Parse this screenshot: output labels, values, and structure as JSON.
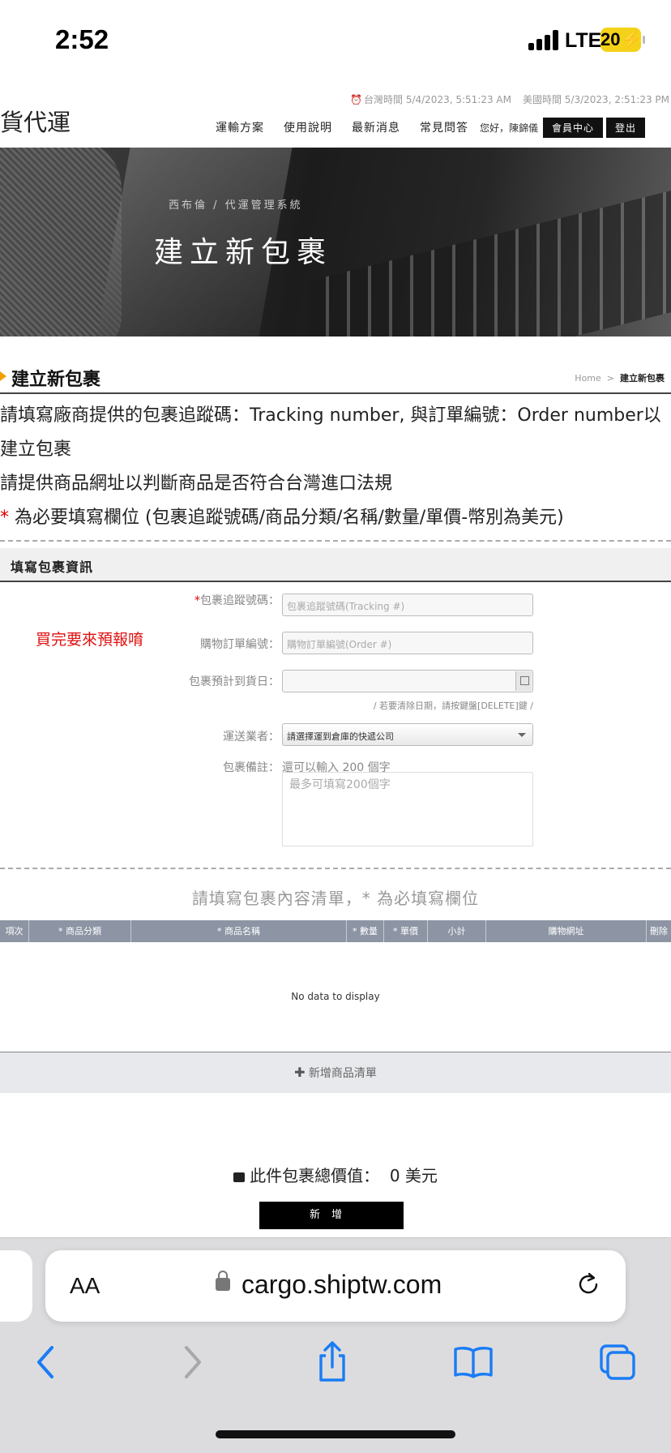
{
  "status_bar": {
    "time": "2:52",
    "network": "LTE",
    "battery": "20"
  },
  "site": {
    "logo": "貨代運",
    "tw_time": "台灣時間 5/4/2023, 5:51:23 AM",
    "us_time": "美國時間 5/3/2023, 2:51:23 PM",
    "nav": [
      "運輸方案",
      "使用說明",
      "最新消息",
      "常見問答"
    ],
    "greeting": "您好，陳錦儀",
    "member_center": "會員中心",
    "logout": "登出"
  },
  "hero": {
    "breadcrumb": "西布倫 / 代運管理系統",
    "title": "建立新包裹"
  },
  "section": {
    "title": "建立新包裹",
    "breadcrumb_home": "Home",
    "breadcrumb_sep": ">",
    "breadcrumb_current": "建立新包裹"
  },
  "intro": {
    "line1": "請填寫廠商提供的包裹追蹤碼：Tracking number, 與訂單編號：Order number以建立包裹",
    "line2": "請提供商品網址以判斷商品是否符合台灣進口法規",
    "line3_star": "*",
    "line3": " 為必要填寫欄位 (包裹追蹤號碼/商品分類/名稱/數量/單價-幣別為美元)"
  },
  "form": {
    "header": "填寫包裹資訊",
    "tracking_label_star": "*",
    "tracking_label": "包裹追蹤號碼：",
    "tracking_placeholder": "包裹追蹤號碼(Tracking #)",
    "order_label": "購物訂單編號：",
    "order_placeholder": "購物訂單編號(Order #)",
    "eta_label": "包裹預計到貨日：",
    "eta_value": "",
    "eta_hint": "/ 若要清除日期，請按鍵盤[DELETE]鍵 /",
    "carrier_label": "運送業者：",
    "carrier_selected": "請選擇運到倉庫的快遞公司",
    "note_label": "包裹備註：",
    "note_counter": "還可以輸入 200 個字",
    "note_placeholder": "最多可填寫200個字",
    "annotation": "買完要來預報唷"
  },
  "items": {
    "title": "請填寫包裹內容清單，* 為必填寫欄位",
    "columns": [
      "項次",
      "* 商品分類",
      "* 商品名稱",
      "* 數量",
      "* 單價",
      "小計",
      "購物網址",
      "刪除"
    ],
    "empty": "No data to display",
    "add_button": "新增商品清單"
  },
  "total": {
    "label": "此件包裹總價值：",
    "value": "0 美元"
  },
  "submit": "新增",
  "browser": {
    "aa": "AA",
    "url": "cargo.shiptw.com"
  },
  "colors": {
    "accent": "#f2a000",
    "required": "#dd0000",
    "annotation": "#e01010",
    "table_header": "#8d95a4",
    "ios_blue": "#1a7cf5"
  }
}
